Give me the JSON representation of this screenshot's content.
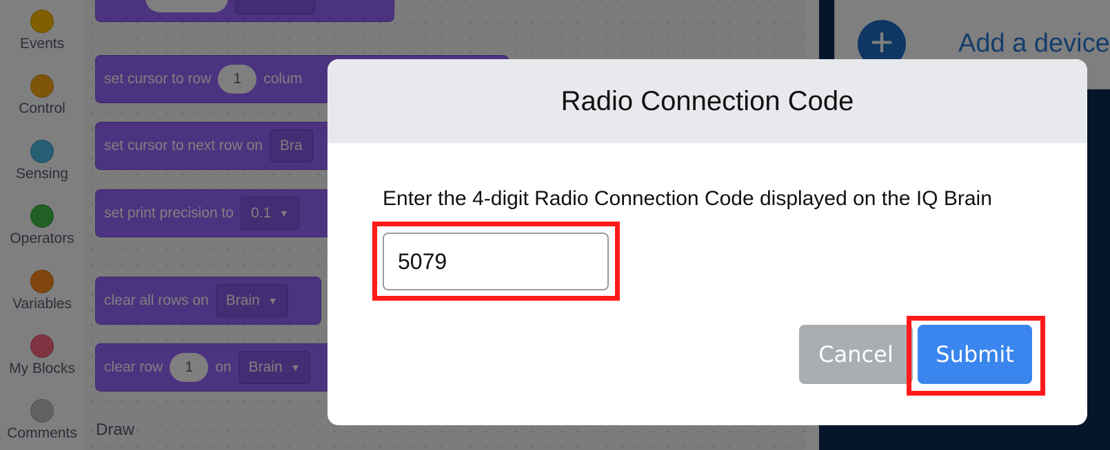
{
  "sidebar": {
    "categories": [
      {
        "label": "Events",
        "color": "#ffbf00"
      },
      {
        "label": "Control",
        "color": "#ffab19"
      },
      {
        "label": "Sensing",
        "color": "#4cbfe6"
      },
      {
        "label": "Operators",
        "color": "#40bf4a"
      },
      {
        "label": "Variables",
        "color": "#ff8c1a"
      },
      {
        "label": "My Blocks",
        "color": "#ff6680"
      },
      {
        "label": "Comments",
        "color": "#c4c4c4"
      }
    ]
  },
  "palette": {
    "blocks": [
      {
        "text": "set cursor to row",
        "oval": "1",
        "tail": "colum"
      },
      {
        "text": "set cursor to next row on",
        "dropdown": "Bra"
      },
      {
        "text": "set print precision to",
        "dropdown": "0.1"
      },
      {
        "text": "clear all rows on",
        "dropdown": "Brain"
      },
      {
        "text": "clear row",
        "oval": "1",
        "mid": "on",
        "dropdown": "Brain"
      }
    ],
    "section_label": "Draw"
  },
  "devices": {
    "add_label": "Add a device",
    "add_icon": "plus-icon"
  },
  "modal": {
    "title": "Radio Connection Code",
    "instruction": "Enter the 4-digit Radio Connection Code displayed on the IQ Brain",
    "code_value": "5079",
    "cancel_label": "Cancel",
    "submit_label": "Submit"
  },
  "colors": {
    "block_purple": "#9966ff",
    "submit_blue": "#3a86ee",
    "cancel_gray": "#a9aeb3",
    "highlight_red": "#ff1a1a"
  }
}
